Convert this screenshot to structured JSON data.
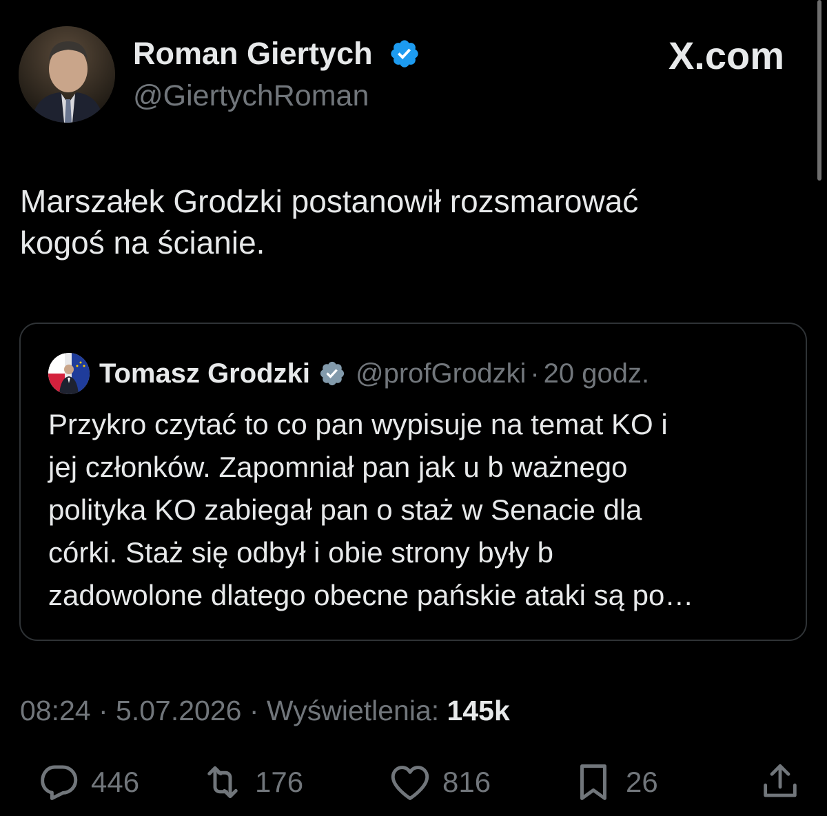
{
  "brand": {
    "label": "X.com"
  },
  "author": {
    "name": "Roman Giertych",
    "handle": "@GiertychRoman",
    "verified_color": "#1d9bf0"
  },
  "tweet": {
    "lines": [
      "Marszałek Grodzki postanowił rozsmarować",
      "kogoś na ścianie."
    ]
  },
  "quote": {
    "name": "Tomasz Grodzki",
    "handle": "@profGrodzki",
    "separator": "·",
    "time": "20 godz.",
    "verified_color": "#829aab",
    "lines": [
      "Przykro czytać to co pan wypisuje na temat KO i",
      "jej członków. Zapomniał pan jak u b ważnego",
      "polityka KO zabiegał pan o staż w Senacie dla",
      "córki. Staż się odbył i obie strony były b",
      "zadowolone dlatego obecne pańskie ataki są po…"
    ]
  },
  "meta": {
    "time": "08:24",
    "sep1": " · ",
    "date": "5.07.2026",
    "sep2": " · ",
    "views_label": "Wyświetlenia: ",
    "views_count": "145k"
  },
  "actions": {
    "replies": {
      "icon": "reply-icon",
      "count": "446"
    },
    "reposts": {
      "icon": "repost-icon",
      "count": "176"
    },
    "likes": {
      "icon": "heart-icon",
      "count": "816"
    },
    "bookmarks": {
      "icon": "bookmark-icon",
      "count": "26"
    },
    "share": {
      "icon": "share-icon"
    }
  },
  "colors": {
    "background": "#000000",
    "text": "#e7e9ea",
    "muted": "#71767b",
    "border": "#2f3336"
  }
}
